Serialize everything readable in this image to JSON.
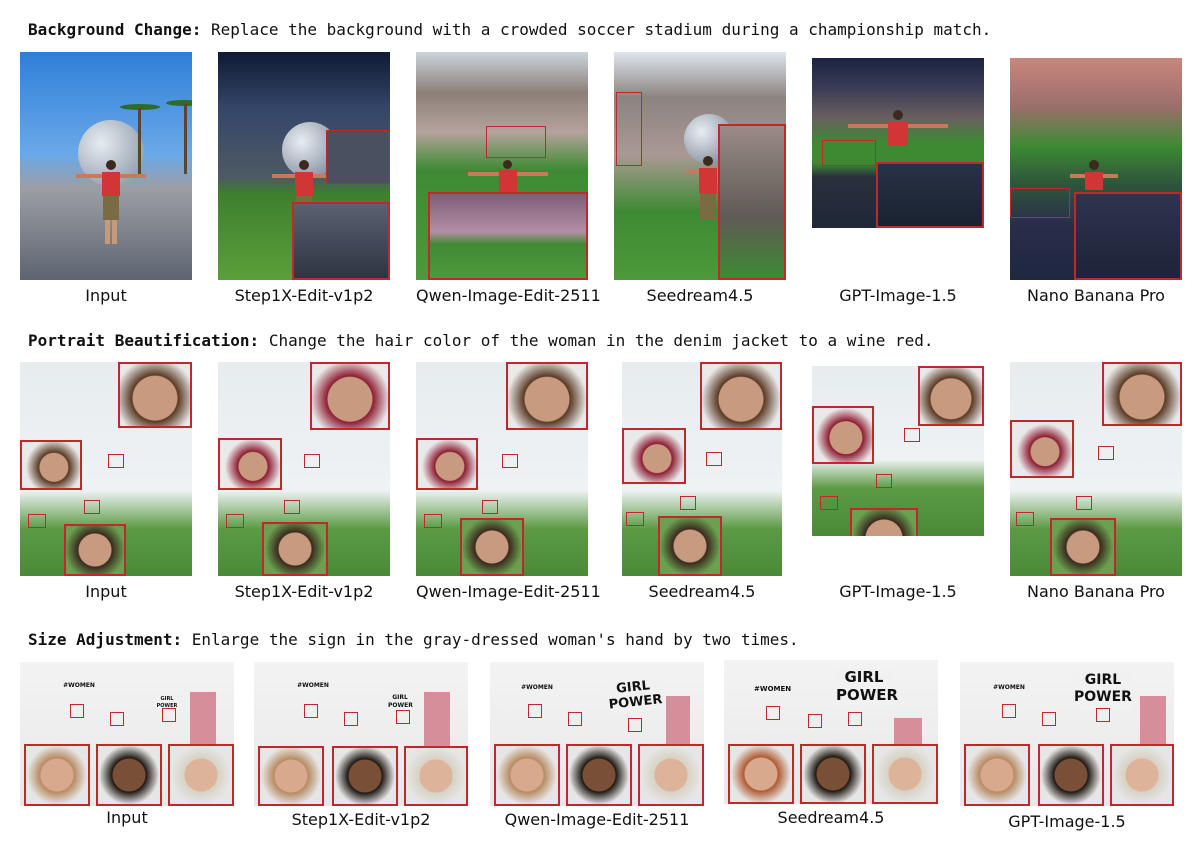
{
  "sections": [
    {
      "heading": "Background Change:",
      "instruction": "Replace the background with a crowded soccer stadium during a championship match.",
      "captions": [
        "Input",
        "Step1X-Edit-v1p2",
        "Qwen-Image-Edit-2511",
        "Seedream4.5",
        "GPT-Image-1.5",
        "Nano Banana Pro"
      ]
    },
    {
      "heading": "Portrait Beautification:",
      "instruction": "Change the hair color of the woman in the denim jacket to a wine red.",
      "captions": [
        "Input",
        "Step1X-Edit-v1p2",
        "Qwen-Image-Edit-2511",
        "Seedream4.5",
        "GPT-Image-1.5",
        "Nano Banana Pro"
      ]
    },
    {
      "heading": "Size Adjustment:",
      "instruction": "Enlarge the sign in the gray-dressed woman's hand by two times.",
      "captions": [
        "Input",
        "Step1X-Edit-v1p2",
        "Qwen-Image-Edit-2511",
        "Seedream4.5",
        "GPT-Image-1.5"
      ]
    }
  ],
  "signs": {
    "women": "#WOMEN",
    "girl_power_line1": "GIRL",
    "girl_power_line2": "POWER"
  },
  "colors": {
    "highlight_box": "#c0282e",
    "hair_wine_red": "#8e1d33",
    "hair_brown": "#5a3a24",
    "grass": "#4f8a36",
    "sky": "#3f86d4"
  }
}
